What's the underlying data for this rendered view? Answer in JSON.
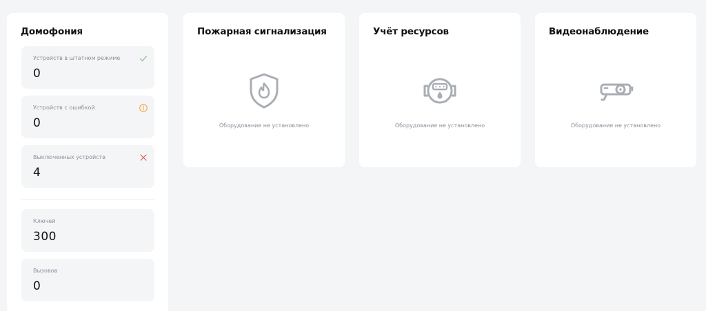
{
  "intercom": {
    "title": "Домофония",
    "stats": [
      {
        "label": "Устройств в штатном режиме",
        "value": "0",
        "icon": "check-icon",
        "color": "#7fbf7f"
      },
      {
        "label": "Устройств с ошибкой",
        "value": "0",
        "icon": "warning-icon",
        "color": "#f5a63c"
      },
      {
        "label": "Выключенных устройств",
        "value": "4",
        "icon": "cross-icon",
        "color": "#e85c5c"
      }
    ],
    "counters": [
      {
        "label": "Ключей",
        "value": "300"
      },
      {
        "label": "Вызовов",
        "value": "0"
      }
    ]
  },
  "fire_alarm": {
    "title": "Пожарная сигнализация",
    "empty_text": "Оборудование не установлено",
    "icon": "shield-flame-icon"
  },
  "resources": {
    "title": "Учёт ресурсов",
    "empty_text": "Оборудование не установлено",
    "icon": "meter-icon"
  },
  "video": {
    "title": "Видеонаблюдение",
    "empty_text": "Оборудование не установлено",
    "icon": "camera-icon"
  },
  "colors": {
    "icon_gray": "#a9adb4",
    "background": "#f4f5f7",
    "card": "#ffffff"
  }
}
